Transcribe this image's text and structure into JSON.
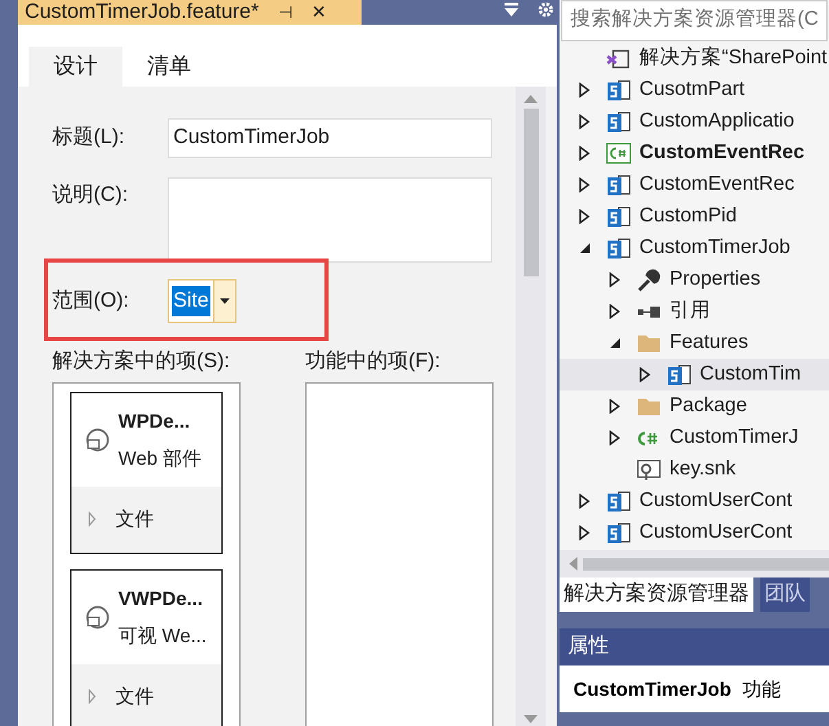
{
  "document_tab": {
    "title": "CustomTimerJob.feature*",
    "pin": "⊣",
    "close": "✕"
  },
  "designer_tabs": [
    {
      "label": "设计",
      "selected": true
    },
    {
      "label": "清单",
      "selected": false
    }
  ],
  "form": {
    "title_label": "标题(L):",
    "title_value": "CustomTimerJob",
    "description_label": "说明(C):",
    "scope_label": "范围(O):",
    "scope_value": "Site",
    "solution_items_label": "解决方案中的项(S):",
    "feature_items_label": "功能中的项(F):"
  },
  "solution_items": [
    {
      "name": "WPDe...",
      "type": "Web 部件",
      "files": "文件"
    },
    {
      "name": "VWPDe...",
      "type": "可视 We...",
      "files": "文件"
    }
  ],
  "explorer": {
    "search_placeholder": "搜索解决方案资源管理器(C",
    "tree": [
      {
        "label": "解决方案“SharePoint",
        "kind": "solution",
        "bold": false,
        "selected": false,
        "children": [
          {
            "label": "CusotmPart",
            "kind": "sp",
            "expanded": false,
            "bold": false,
            "selected": false
          },
          {
            "label": "CustomApplicatio",
            "kind": "sp",
            "expanded": false,
            "bold": false,
            "selected": false
          },
          {
            "label": "CustomEventRec",
            "kind": "csproj",
            "expanded": false,
            "bold": true,
            "selected": false
          },
          {
            "label": "CustomEventRec",
            "kind": "sp",
            "expanded": false,
            "bold": false,
            "selected": false
          },
          {
            "label": "CustomPid",
            "kind": "sp",
            "expanded": false,
            "bold": false,
            "selected": false
          },
          {
            "label": "CustomTimerJob",
            "kind": "sp",
            "expanded": true,
            "bold": false,
            "selected": false,
            "children": [
              {
                "label": "Properties",
                "kind": "wrench",
                "expanded": false,
                "bold": false,
                "selected": false
              },
              {
                "label": "引用",
                "kind": "refs",
                "expanded": false,
                "bold": false,
                "selected": false
              },
              {
                "label": "Features",
                "kind": "folder",
                "expanded": true,
                "bold": false,
                "selected": false,
                "children": [
                  {
                    "label": "CustomTim",
                    "kind": "feature",
                    "expanded": false,
                    "bold": false,
                    "selected": true
                  }
                ]
              },
              {
                "label": "Package",
                "kind": "folder",
                "expanded": false,
                "bold": false,
                "selected": false
              },
              {
                "label": "CustomTimerJ",
                "kind": "cs",
                "expanded": false,
                "bold": false,
                "selected": false
              },
              {
                "label": "key.snk",
                "kind": "key",
                "bold": false,
                "selected": false
              }
            ]
          },
          {
            "label": "CustomUserCont",
            "kind": "sp",
            "expanded": false,
            "bold": false,
            "selected": false
          },
          {
            "label": "CustomUserCont",
            "kind": "sp",
            "expanded": false,
            "bold": false,
            "selected": false
          }
        ]
      }
    ]
  },
  "bottom_tabs": [
    {
      "label": "解决方案资源管理器",
      "selected": true
    },
    {
      "label": "团队",
      "selected": false
    }
  ],
  "properties": {
    "header": "属性",
    "object_name": "CustomTimerJob",
    "object_type": "功能"
  }
}
